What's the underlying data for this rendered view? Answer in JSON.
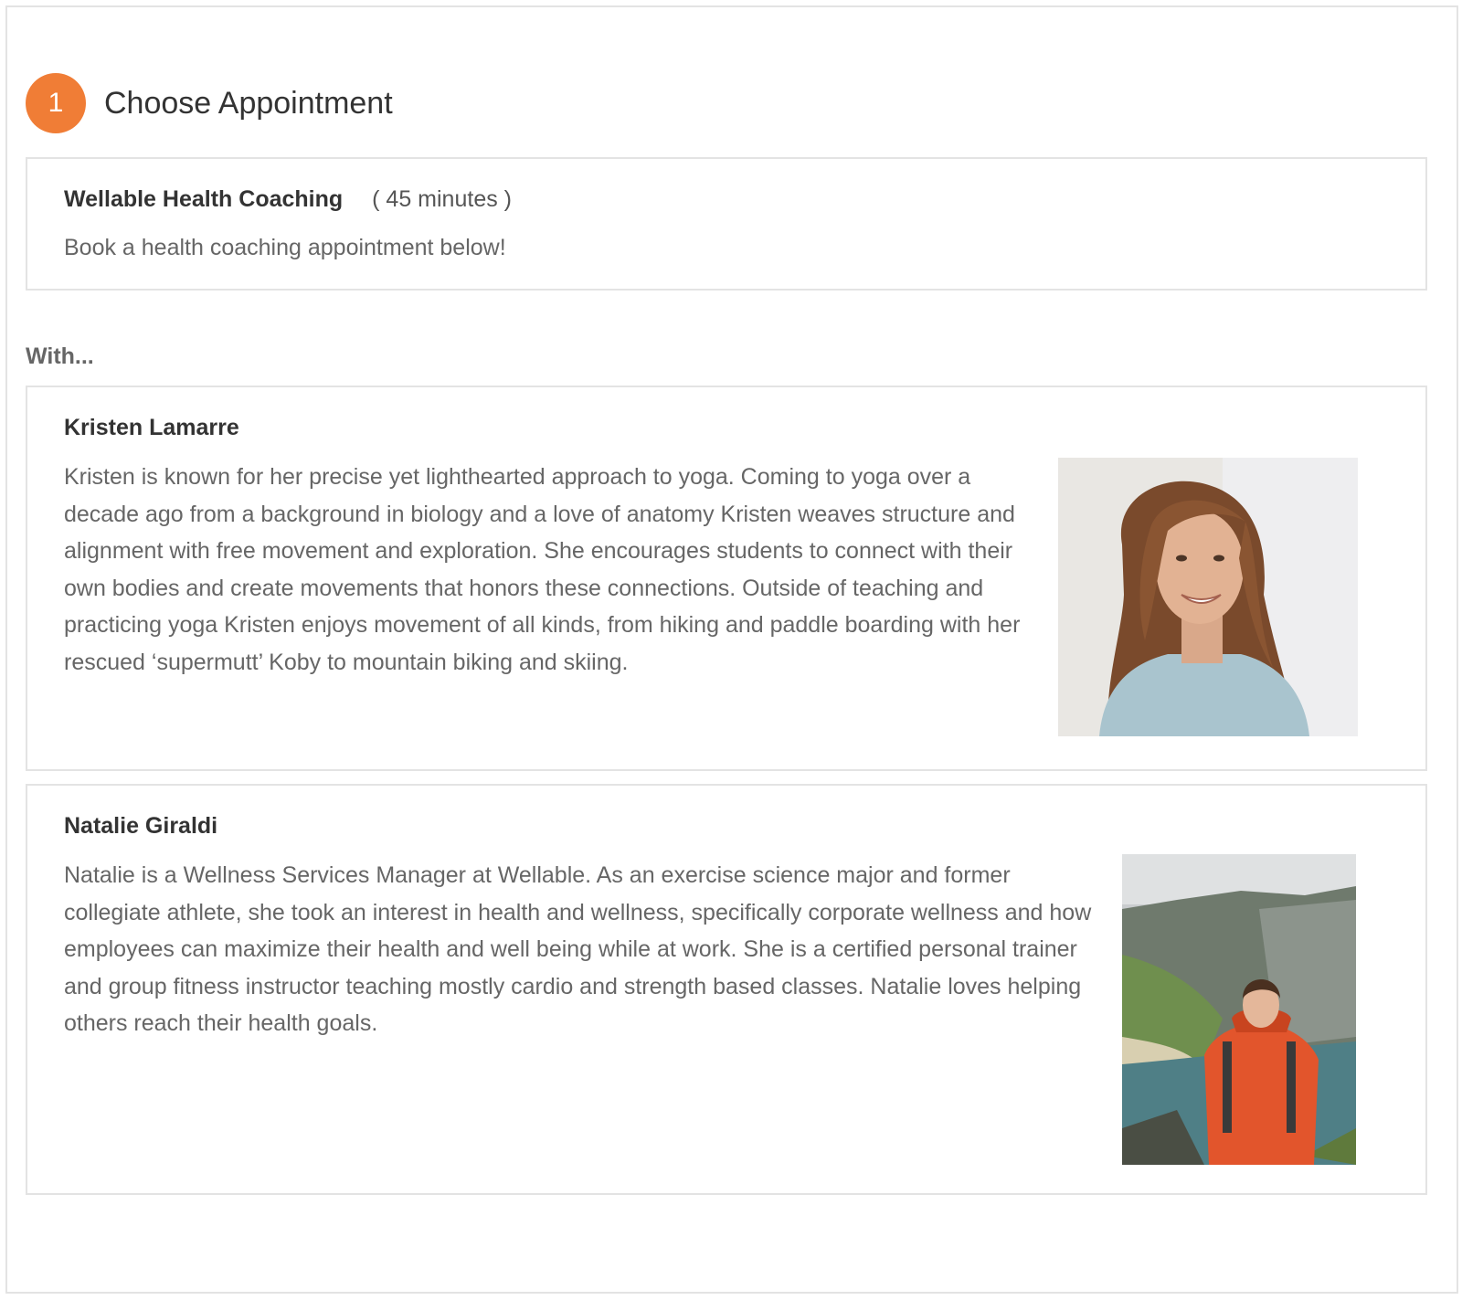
{
  "step": {
    "number": "1",
    "title": "Choose Appointment"
  },
  "service": {
    "name": "Wellable Health Coaching",
    "duration": "( 45 minutes )",
    "description": "Book a health coaching appointment below!"
  },
  "with_label": "With...",
  "coaches": [
    {
      "name": "Kristen Lamarre",
      "bio": "Kristen is known for her precise yet lighthearted approach to yoga. Coming to yoga over a decade ago from a background in biology and a love of anatomy Kristen weaves structure and alignment with free movement and exploration. She encourages students to connect with their own bodies and create movements that honors these connections. Outside of teaching and practicing yoga Kristen enjoys movement of all kinds, from hiking and paddle boarding with her rescued ‘supermutt’ Koby to mountain biking and skiing."
    },
    {
      "name": "Natalie Giraldi",
      "bio": "Natalie is a Wellness Services Manager at Wellable. As an exercise science major and former collegiate athlete, she took an interest in health and wellness, specifically corporate wellness and how employees can maximize their health and well being while at work. She is a certified personal trainer and group fitness instructor teaching mostly cardio and strength based classes. Natalie loves helping others reach their health goals."
    }
  ],
  "colors": {
    "accent": "#f07d36",
    "border": "#e3e3e3",
    "heading": "#333333",
    "body_text": "#666666"
  }
}
